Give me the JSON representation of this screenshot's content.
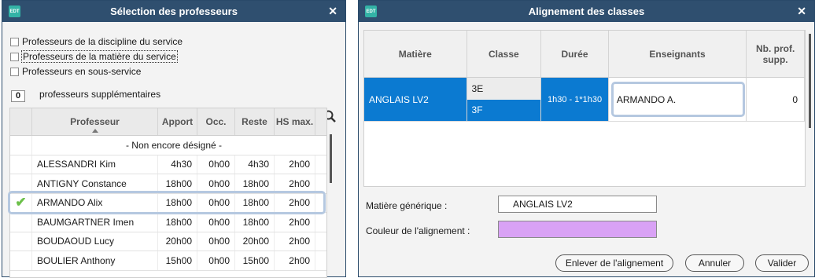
{
  "left_dialog": {
    "logo": "EDT",
    "title": "Sélection des professeurs",
    "options": [
      "Professeurs de la discipline du service",
      "Professeurs de la matière du service",
      "Professeurs en sous-service"
    ],
    "supp_count": "0",
    "supp_label": "professeurs supplémentaires",
    "columns": [
      "Professeur",
      "Apport",
      "Occ.",
      "Reste",
      "HS max."
    ],
    "not_assigned": "- Non encore désigné -",
    "rows": [
      {
        "name": "ALESSANDRI Kim",
        "apport": "4h30",
        "occ": "0h00",
        "reste": "4h30",
        "hs": "2h00"
      },
      {
        "name": "ANTIGNY Constance",
        "apport": "18h00",
        "occ": "0h00",
        "reste": "18h00",
        "hs": "2h00"
      },
      {
        "name": "ARMANDO Alix",
        "apport": "18h00",
        "occ": "0h00",
        "reste": "18h00",
        "hs": "2h00"
      },
      {
        "name": "BAUMGARTNER Imen",
        "apport": "18h00",
        "occ": "0h00",
        "reste": "18h00",
        "hs": "2h00"
      },
      {
        "name": "BOUDAOUD Lucy",
        "apport": "20h00",
        "occ": "0h00",
        "reste": "20h00",
        "hs": "2h00"
      },
      {
        "name": "BOULIER Anthony",
        "apport": "15h00",
        "occ": "0h00",
        "reste": "15h00",
        "hs": "2h00"
      }
    ]
  },
  "right_dialog": {
    "logo": "EDT",
    "title": "Alignement des classes",
    "columns": [
      "Matière",
      "Classe",
      "Durée",
      "Enseignants",
      "Nb. prof. supp."
    ],
    "row": {
      "matiere": "ANGLAIS LV2",
      "classes": [
        "3E",
        "3F"
      ],
      "duree": "1h30 - 1*1h30",
      "enseignants": "ARMANDO A.",
      "nb_prof": "0"
    },
    "generic_label": "Matière générique :",
    "generic_value": "ANGLAIS LV2",
    "color_label": "Couleur de l'alignement :",
    "color_value": "#d9a2f5",
    "buttons": {
      "remove": "Enlever de l'alignement",
      "cancel": "Annuler",
      "validate": "Valider"
    }
  }
}
